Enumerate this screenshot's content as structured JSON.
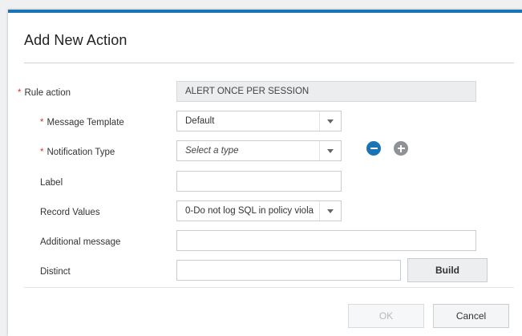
{
  "dialog": {
    "title": "Add New Action",
    "required_marker": "*",
    "fields": {
      "rule_action": {
        "label": "Rule action",
        "value": "ALERT ONCE PER SESSION"
      },
      "message_template": {
        "label": "Message Template",
        "value": "Default"
      },
      "notification_type": {
        "label": "Notification Type",
        "value": "Select a type"
      },
      "label": {
        "label": "Label",
        "value": ""
      },
      "record_values": {
        "label": "Record Values",
        "value": "0-Do not log SQL in policy viola"
      },
      "additional_message": {
        "label": "Additional message",
        "value": ""
      },
      "distinct": {
        "label": "Distinct",
        "value": ""
      }
    },
    "buttons": {
      "build": "Build",
      "ok": "OK",
      "cancel": "Cancel"
    },
    "icons": {
      "remove": "minus-circle-icon",
      "add": "plus-circle-icon"
    },
    "colors": {
      "accent": "#1a74b4",
      "required": "#d2372c",
      "add_icon": "#8e9296"
    }
  }
}
